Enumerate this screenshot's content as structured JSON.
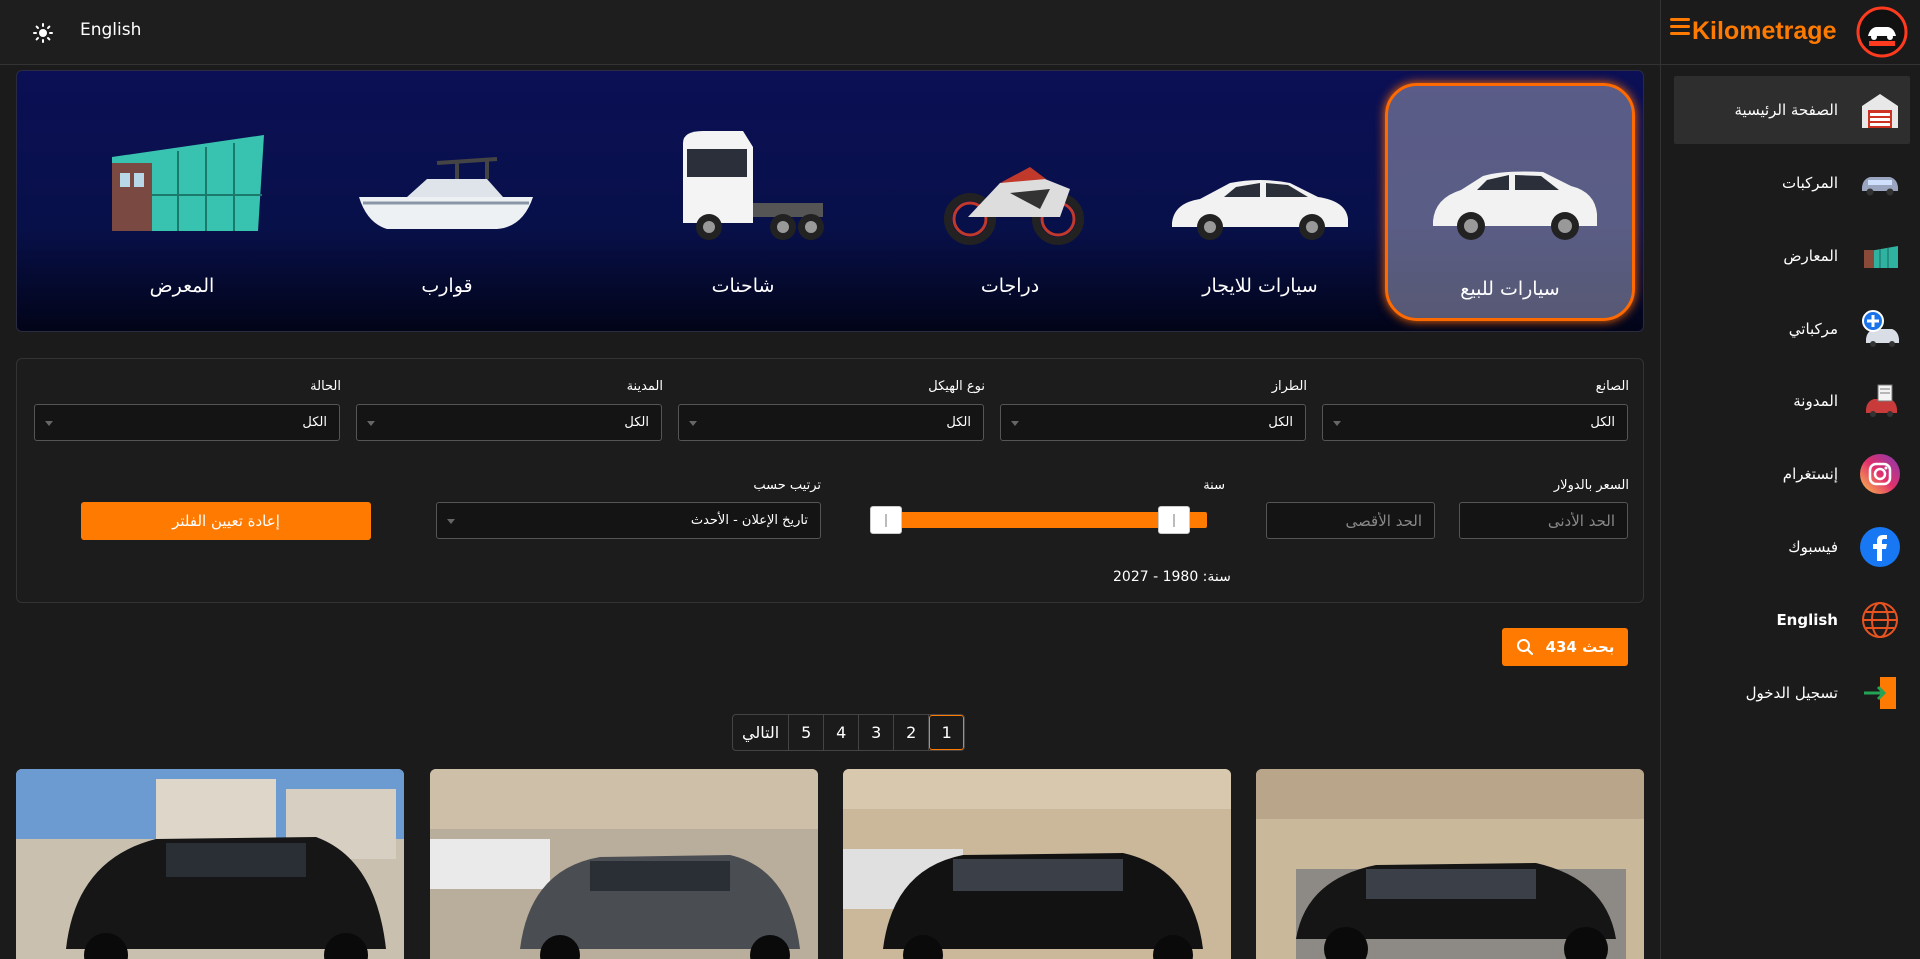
{
  "topbar": {
    "language": "English"
  },
  "sidebar": {
    "brand": "Kilometrage",
    "items": [
      {
        "label": "الصفحة الرئيسية",
        "icon": "garage-icon"
      },
      {
        "label": "المركبات",
        "icon": "car-icon"
      },
      {
        "label": "المعارض",
        "icon": "showroom-icon"
      },
      {
        "label": "مركباتي",
        "icon": "add-vehicle-icon"
      },
      {
        "label": "المدونة",
        "icon": "blog-icon"
      },
      {
        "label": "إنستغرام",
        "icon": "instagram-icon"
      },
      {
        "label": "فيسبوك",
        "icon": "facebook-icon"
      },
      {
        "label": "English",
        "icon": "globe-icon"
      },
      {
        "label": "تسجيل الدخول",
        "icon": "login-icon"
      }
    ]
  },
  "categories": [
    {
      "label": "سيارات للبيع",
      "active": true
    },
    {
      "label": "سيارات للايجار"
    },
    {
      "label": "دراجات"
    },
    {
      "label": "شاحنات"
    },
    {
      "label": "قوارب"
    },
    {
      "label": "المعرض"
    }
  ],
  "filters": {
    "make": {
      "label": "الصانع",
      "value": "الكل"
    },
    "model": {
      "label": "الطراز",
      "value": "الكل"
    },
    "body": {
      "label": "نوع الهيكل",
      "value": "الكل"
    },
    "city": {
      "label": "المدينة",
      "value": "الكل"
    },
    "condition": {
      "label": "الحالة",
      "value": "الكل"
    },
    "price": {
      "label": "السعر بالدولار",
      "min_placeholder": "الحد الأدنى",
      "max_placeholder": "الحد الأقصى"
    },
    "year": {
      "label": "سنة",
      "range_text": "سنة: 1980 - 2027",
      "min": 1980,
      "max": 2027
    },
    "sort": {
      "label": "ترتيب حسب",
      "value": "تاريخ الإعلان - الأحدث"
    },
    "reset_label": "إعادة تعيين الفلتر"
  },
  "search": {
    "label": "بحث 434"
  },
  "pagination": {
    "pages": [
      "1",
      "2",
      "3",
      "4",
      "5"
    ],
    "current": "1",
    "next_label": "التالي"
  },
  "colors": {
    "accent": "#ff7a00",
    "background": "#1b1b1b",
    "banner": "#0b0f55"
  }
}
